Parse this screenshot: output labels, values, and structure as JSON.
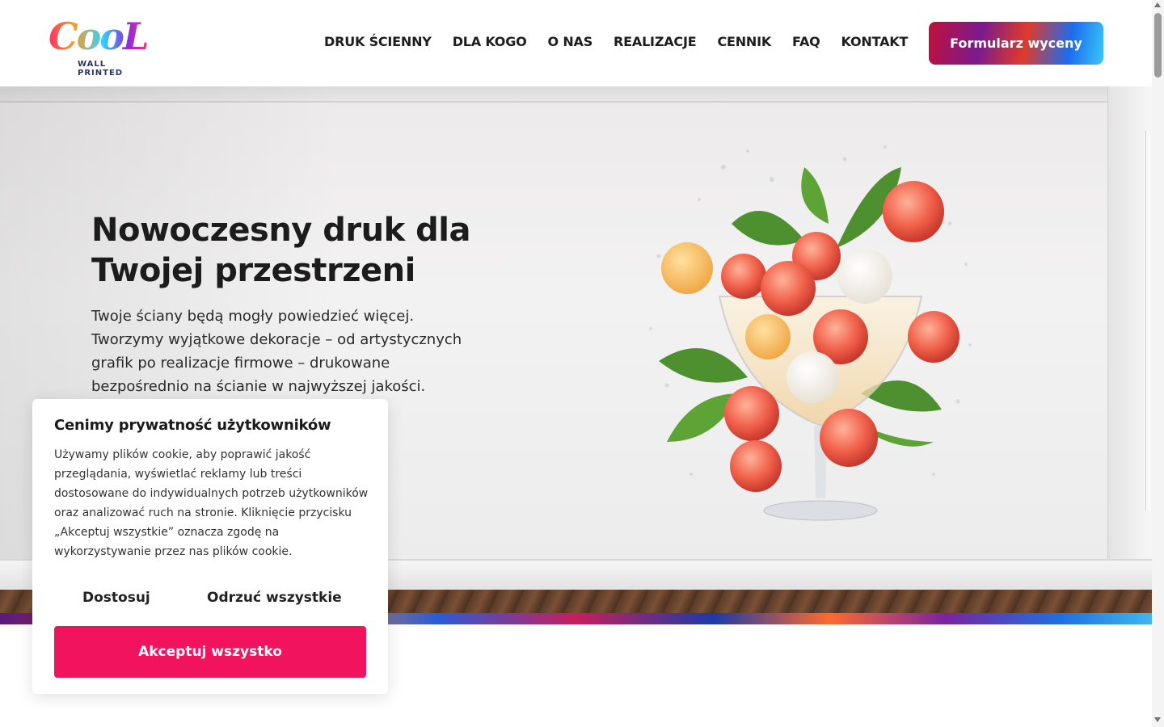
{
  "header": {
    "logo_main": "CooL",
    "logo_sub": "WALL PRINTED",
    "nav": [
      {
        "label": "DRUK ŚCIENNY"
      },
      {
        "label": "DLA KOGO"
      },
      {
        "label": "O NAS"
      },
      {
        "label": "REALIZACJE"
      },
      {
        "label": "CENNIK"
      },
      {
        "label": "FAQ"
      },
      {
        "label": "KONTAKT"
      }
    ],
    "cta_label": "Formularz wyceny"
  },
  "hero": {
    "title_line1": "Nowoczesny druk dla",
    "title_line2": "Twojej przestrzeni",
    "text": "Twoje ściany będą mogły powiedzieć więcej. Tworzymy wyjątkowe dekoracje – od artystycznych grafik po realizacje firmowe – drukowane bezpośrednio na ścianie w najwyższej jakości.",
    "artwork_icon": "lychee-cocktail-artwork-icon"
  },
  "cookie": {
    "title": "Cenimy prywatność użytkowników",
    "text": "Używamy plików cookie, aby poprawić jakość przeglądania, wyświetlać reklamy lub treści dostosowane do indywidualnych potrzeb użytkowników oraz analizować ruch na stronie. Kliknięcie przycisku „Akceptuj wszystkie” oznacza zgodę na wykorzystywanie przez nas plików cookie.",
    "customize_label": "Dostosuj",
    "reject_label": "Odrzuć wszystkie",
    "accept_label": "Akceptuj wszystko"
  },
  "colors": {
    "accent": "#f2135e",
    "text": "#1c1c1c"
  }
}
